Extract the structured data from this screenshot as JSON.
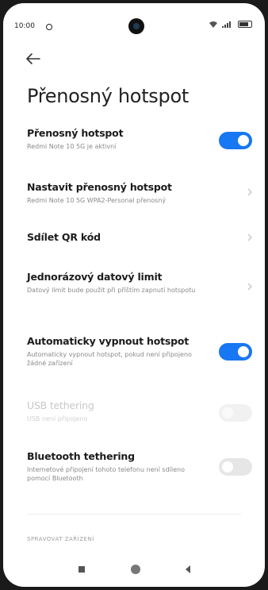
{
  "status_bar": {
    "time": "10:00"
  },
  "page": {
    "title": "Přenosný hotspot"
  },
  "settings": [
    {
      "title": "Přenosný hotspot",
      "subtitle": "Redmi Note 10 5G je aktivní",
      "control": "toggle",
      "state": "on"
    },
    {
      "title": "Nastavit přenosný hotspot",
      "subtitle": "Redmi Note 10 5G WPA2-Personal přenosný",
      "control": "chevron"
    },
    {
      "title": "Sdílet QR kód",
      "subtitle": "",
      "control": "chevron"
    },
    {
      "title": "Jednorázový datový limit",
      "subtitle": "Datový limit bude použit při příštím zapnutí hotspotu",
      "control": "chevron"
    },
    {
      "title": "Automaticky vypnout hotspot",
      "subtitle": "Automaticky vypnout hotspot, pokud není připojeno žádné zařízení",
      "control": "toggle",
      "state": "on"
    },
    {
      "title": "USB tethering",
      "subtitle": "USB není připojeno",
      "control": "toggle",
      "state": "disabled"
    },
    {
      "title": "Bluetooth tethering",
      "subtitle": "Internetové připojení tohoto telefonu není sdíleno pomocí Bluetooth",
      "control": "toggle",
      "state": "off"
    }
  ],
  "section": {
    "label": "SPRAVOVAT ZAŘÍZENÍ"
  },
  "colors": {
    "accent": "#1877f2",
    "background": "#ffffff"
  }
}
